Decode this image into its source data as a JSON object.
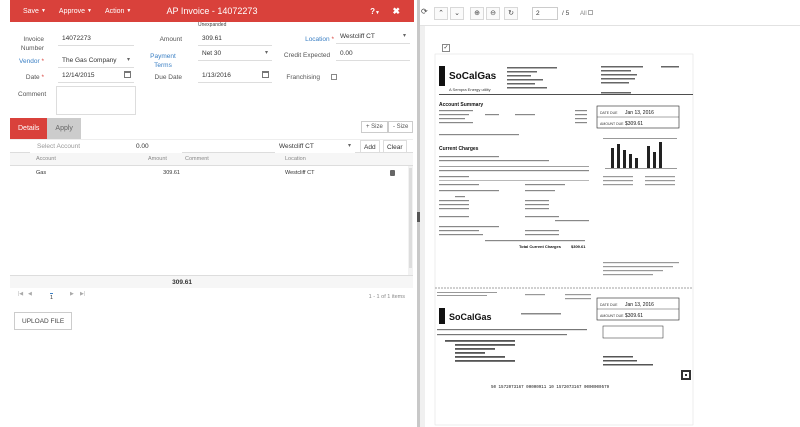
{
  "header": {
    "save": "Save",
    "approve": "Approve",
    "action": "Action",
    "title": "AP Invoice - 14072273",
    "help_icon": "?",
    "close_icon": "✖",
    "unexpanded": "Unexpanded"
  },
  "form": {
    "invoice_number_label": "Invoice Number",
    "invoice_number": "14072273",
    "vendor_label": "Vendor",
    "vendor": "The Gas Company",
    "date_label": "Date",
    "date": "12/14/2015",
    "comment_label": "Comment",
    "amount_label": "Amount",
    "amount": "309.61",
    "payment_terms_label": "Payment Terms",
    "payment_terms": "Net 30",
    "due_date_label": "Due Date",
    "due_date": "1/13/2016",
    "location_label": "Location",
    "location": "Westcliff CT",
    "credit_expected_label": "Credit Expected",
    "credit_expected": "0.00",
    "franchising_label": "Franchising"
  },
  "tabs": {
    "details": "Details",
    "apply": "Apply",
    "plus_size": "+ Size",
    "minus_size": "- Size"
  },
  "line_entry": {
    "account_placeholder": "Select Account",
    "amount": "0.00",
    "location": "Westcliff CT",
    "add": "Add",
    "clear": "Clear"
  },
  "grid": {
    "columns": [
      "Account",
      "Amount",
      "Comment",
      "Location"
    ],
    "rows": [
      {
        "account": "Gas",
        "amount": "309.61",
        "comment": "",
        "location": "Westcliff CT"
      }
    ],
    "total": "309.61"
  },
  "pager": {
    "page": "1",
    "info": "1 - 1 of 1 items",
    "first": "|◀",
    "prev": "◀",
    "next": "▶",
    "last": "▶|"
  },
  "upload_label": "UPLOAD FILE",
  "viewer": {
    "page_input": "2",
    "page_count": "/ 5",
    "all_label": "All",
    "checked_mark": "✓"
  },
  "document": {
    "brand": "SoCalGas",
    "brand_sub": "A Sempra Energy utility",
    "account_summary": "Account Summary",
    "current_charges": "Current Charges",
    "date_due_label": "DATE DUE",
    "date_due": "Jan 13, 2016",
    "amount_due_label": "AMOUNT DUE",
    "amount_due": "$309.61",
    "total_current_charges": "Total Current Charges",
    "total_value": "$309.61",
    "stub_date_label": "DATE DUE",
    "stub_date": "Jan 13, 2016",
    "stub_amount_label": "AMOUNT DUE",
    "stub_amount": "$309.61",
    "scanline": "50 1572073167 00000911 10   1572073167 0000000579"
  }
}
